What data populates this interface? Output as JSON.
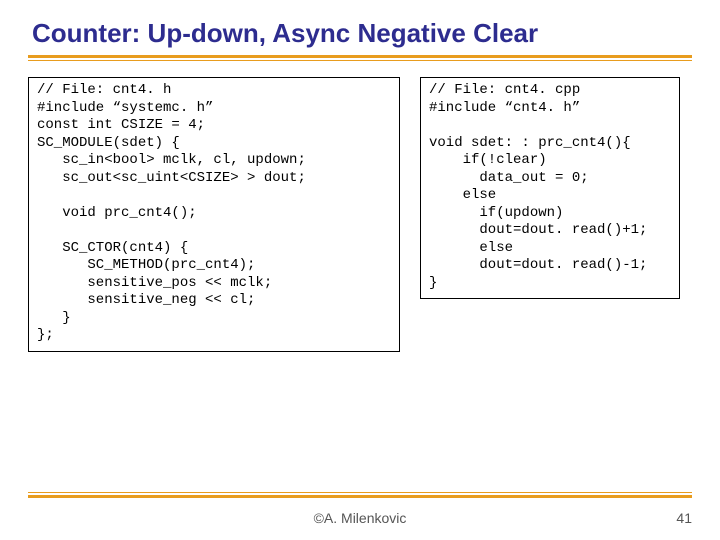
{
  "title": "Counter: Up-down, Async Negative Clear",
  "code_left": "// File: cnt4. h\n#include “systemc. h”\nconst int CSIZE = 4;\nSC_MODULE(sdet) {\n   sc_in<bool> mclk, cl, updown;\n   sc_out<sc_uint<CSIZE> > dout;\n\n   void prc_cnt4();\n\n   SC_CTOR(cnt4) {\n      SC_METHOD(prc_cnt4);\n      sensitive_pos << mclk;\n      sensitive_neg << cl;\n   }\n};",
  "code_right": "// File: cnt4. cpp\n#include “cnt4. h”\n\nvoid sdet: : prc_cnt4(){\n    if(!clear)\n      data_out = 0;\n    else\n      if(updown)\n      dout=dout. read()+1;\n      else\n      dout=dout. read()-1;\n}",
  "footer": {
    "author": "©A. Milenkovic",
    "page": "41"
  }
}
